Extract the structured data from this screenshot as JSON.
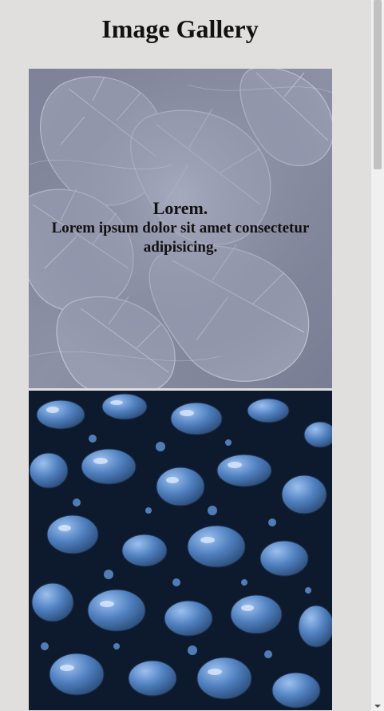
{
  "page": {
    "title": "Image Gallery"
  },
  "gallery": {
    "items": [
      {
        "image": "monstera-leaves-image",
        "caption_title": "Lorem.",
        "caption_text": "Lorem ipsum dolor sit amet consectetur adipisicing."
      },
      {
        "image": "blue-water-drops-image"
      }
    ]
  },
  "colors": {
    "background": "#e0dfde",
    "leaf_tint": "#8e93a8",
    "droplet_blue": "#4a78b8"
  }
}
